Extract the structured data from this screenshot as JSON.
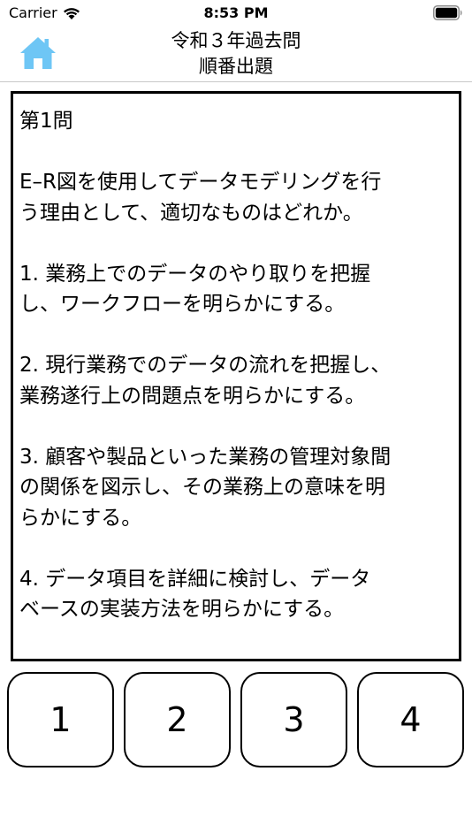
{
  "status_bar": {
    "carrier": "Carrier",
    "time": "8:53 PM"
  },
  "nav": {
    "title": "令和３年過去問",
    "subtitle": "順番出題",
    "home_icon": "home-icon",
    "home_color": "#6ec6f5"
  },
  "question": {
    "number": "第1問",
    "stem_line1": "E–R図を使用してデータモデリングを行",
    "stem_line2": "う理由として、適切なものはどれか。",
    "options": [
      {
        "line1": "1. 業務上でのデータのやり取りを把握",
        "line2": "し、ワークフローを明らかにする。"
      },
      {
        "line1": "2. 現行業務でのデータの流れを把握し、",
        "line2": "業務遂行上の問題点を明らかにする。"
      },
      {
        "line1": "3. 顧客や製品といった業務の管理対象間",
        "line2": "の関係を図示し、その業務上の意味を明",
        "line3": "らかにする。"
      },
      {
        "line1": "4. データ項目を詳細に検討し、データ",
        "line2": "ベースの実装方法を明らかにする。"
      }
    ]
  },
  "answers": [
    {
      "label": "1"
    },
    {
      "label": "2"
    },
    {
      "label": "3"
    },
    {
      "label": "4"
    }
  ]
}
